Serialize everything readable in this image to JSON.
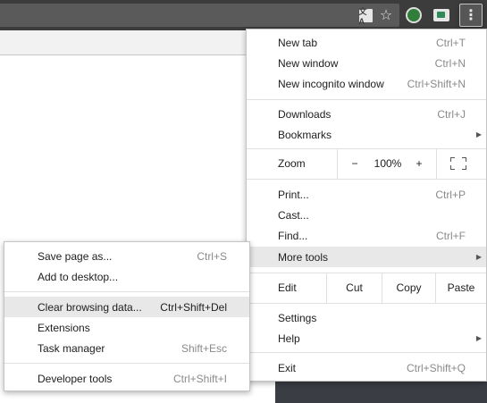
{
  "toolbar": {
    "icons": [
      "translate-icon",
      "star-icon",
      "extension-avatar-icon",
      "extension-icon",
      "more-vertical-icon"
    ],
    "translate_glyph": "文A",
    "star_glyph": "☆",
    "menu_glyph": "⋮"
  },
  "menu": {
    "new_tab": {
      "label": "New tab",
      "shortcut": "Ctrl+T"
    },
    "new_window": {
      "label": "New window",
      "shortcut": "Ctrl+N"
    },
    "new_incognito": {
      "label": "New incognito window",
      "shortcut": "Ctrl+Shift+N"
    },
    "downloads": {
      "label": "Downloads",
      "shortcut": "Ctrl+J"
    },
    "bookmarks": {
      "label": "Bookmarks"
    },
    "zoom": {
      "label": "Zoom",
      "minus": "−",
      "value": "100%",
      "plus": "+"
    },
    "print": {
      "label": "Print...",
      "shortcut": "Ctrl+P"
    },
    "cast": {
      "label": "Cast..."
    },
    "find": {
      "label": "Find...",
      "shortcut": "Ctrl+F"
    },
    "more_tools": {
      "label": "More tools"
    },
    "edit": {
      "label": "Edit",
      "cut": "Cut",
      "copy": "Copy",
      "paste": "Paste"
    },
    "settings": {
      "label": "Settings"
    },
    "help": {
      "label": "Help"
    },
    "exit": {
      "label": "Exit",
      "shortcut": "Ctrl+Shift+Q"
    },
    "arrow": "▶"
  },
  "submenu": {
    "save_page": {
      "label": "Save page as...",
      "shortcut": "Ctrl+S"
    },
    "add_desktop": {
      "label": "Add to desktop..."
    },
    "clear_data": {
      "label": "Clear browsing data...",
      "shortcut": "Ctrl+Shift+Del"
    },
    "extensions": {
      "label": "Extensions"
    },
    "task_manager": {
      "label": "Task manager",
      "shortcut": "Shift+Esc"
    },
    "developer_tools": {
      "label": "Developer tools",
      "shortcut": "Ctrl+Shift+I"
    }
  }
}
